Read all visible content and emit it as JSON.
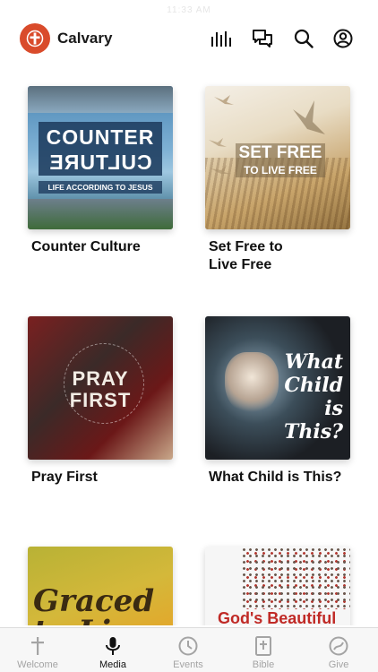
{
  "status_bar": {
    "text": "11:33 AM"
  },
  "header": {
    "app_name": "Calvary",
    "logo_icon": "cross-logo-icon",
    "icons": [
      "audio-bars-icon",
      "chat-bubbles-icon",
      "search-icon",
      "profile-icon"
    ]
  },
  "colors": {
    "brand": "#d94b2b",
    "tab_active": "#111111",
    "tab_inactive": "#a4a4a4"
  },
  "series": [
    {
      "title": "Counter Culture",
      "art_title_top": "COUNTER",
      "art_title_bottom": "CULTURE",
      "art_subtitle": "LIFE ACCORDING TO JESUS"
    },
    {
      "title": "Set Free to\nLive Free",
      "art_line1": "SET FREE",
      "art_line2": "TO LIVE FREE"
    },
    {
      "title": "Pray First",
      "art_line1": "PRAY",
      "art_line2": "FIRST"
    },
    {
      "title": "What Child is This?",
      "art_text": "What\nChild\nis This?"
    },
    {
      "title": "",
      "art_text": "Graced\nto Live"
    },
    {
      "title": "",
      "art_text": "God's Beautiful"
    }
  ],
  "tabs": [
    {
      "label": "Welcome",
      "icon": "cross-icon",
      "active": false
    },
    {
      "label": "Media",
      "icon": "microphone-icon",
      "active": true
    },
    {
      "label": "Events",
      "icon": "clock-icon",
      "active": false
    },
    {
      "label": "Bible",
      "icon": "bible-icon",
      "active": false
    },
    {
      "label": "Give",
      "icon": "give-icon",
      "active": false
    }
  ]
}
